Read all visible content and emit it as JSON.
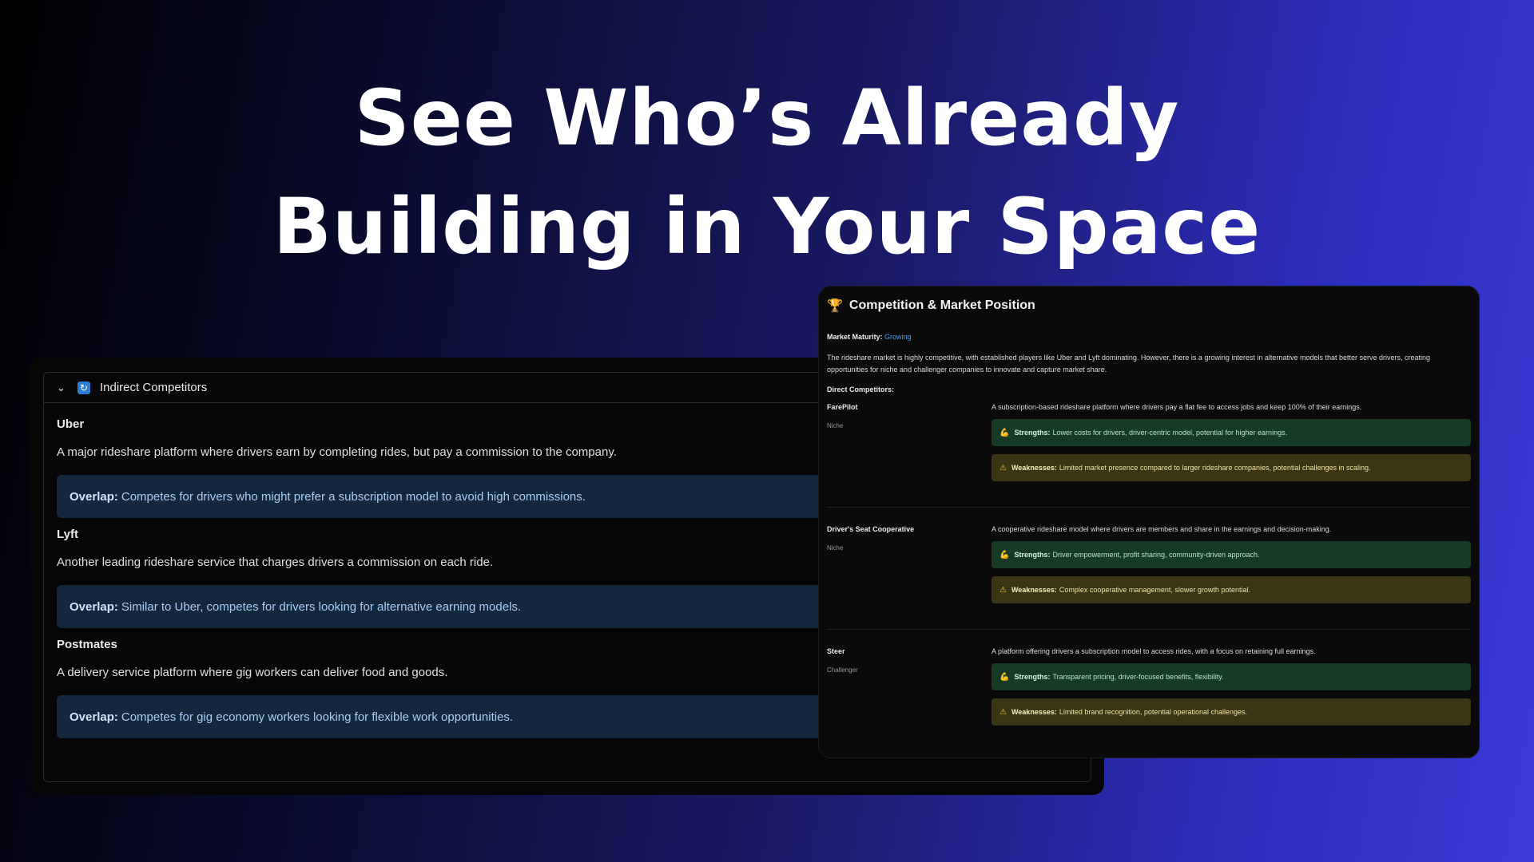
{
  "headline": {
    "line1": "See Who’s Already",
    "line2": "Building in Your Space"
  },
  "indirect": {
    "header_label": "Indirect Competitors",
    "expand_icon": "chevron-down-icon",
    "header_icon": "cycle-icon",
    "overlap_label": "Overlap:",
    "items": [
      {
        "name": "Uber",
        "description": "A major rideshare platform where drivers earn by completing rides, but pay a commission to the company.",
        "overlap": "Competes for drivers who might prefer a subscription model to avoid high commissions."
      },
      {
        "name": "Lyft",
        "description": "Another leading rideshare service that charges drivers a commission on each ride.",
        "overlap": "Similar to Uber, competes for drivers looking for alternative earning models."
      },
      {
        "name": "Postmates",
        "description": "A delivery service platform where gig workers can deliver food and goods.",
        "overlap": "Competes for gig economy workers looking for flexible work opportunities."
      }
    ]
  },
  "competition": {
    "title": "Competition & Market Position",
    "title_icon": "trophy-icon",
    "market_maturity_label": "Market Maturity:",
    "market_maturity_value": "Growing",
    "summary": "The rideshare market is highly competitive, with established players like Uber and Lyft dominating. However, there is a growing interest in alternative models that better serve drivers, creating opportunities for niche and challenger companies to innovate and capture market share.",
    "direct_label": "Direct Competitors:",
    "strengths_label": "Strengths:",
    "weaknesses_label": "Weaknesses:",
    "direct": [
      {
        "name": "FarePilot",
        "type": "Niche",
        "description": "A subscription-based rideshare platform where drivers pay a flat fee to access jobs and keep 100% of their earnings.",
        "strengths": "Lower costs for drivers, driver-centric model, potential for higher earnings.",
        "weaknesses": "Limited market presence compared to larger rideshare companies, potential challenges in scaling."
      },
      {
        "name": "Driver's Seat Cooperative",
        "type": "Niche",
        "description": "A cooperative rideshare model where drivers are members and share in the earnings and decision-making.",
        "strengths": "Driver empowerment, profit sharing, community-driven approach.",
        "weaknesses": "Complex cooperative management, slower growth potential."
      },
      {
        "name": "Steer",
        "type": "Challenger",
        "description": "A platform offering drivers a subscription model to access rides, with a focus on retaining full earnings.",
        "strengths": "Transparent pricing, driver-focused benefits, flexibility.",
        "weaknesses": "Limited brand recognition, potential operational challenges."
      }
    ]
  }
}
